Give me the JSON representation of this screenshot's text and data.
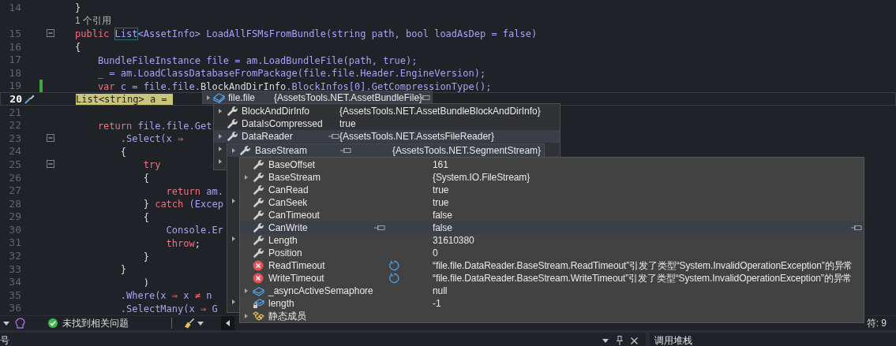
{
  "editor": {
    "lines": [
      {
        "kind": "code",
        "number": "14",
        "tokens": [
          {
            "kind": "punct",
            "text": "}"
          }
        ]
      },
      {
        "kind": "codelens",
        "text": "1 个引用"
      },
      {
        "kind": "code",
        "number": "15",
        "fold": true,
        "tokens": [
          {
            "kind": "keyword",
            "text": "public "
          },
          {
            "kind": "reference",
            "text": "List"
          },
          {
            "kind": "name",
            "text": "<AssetInfo> LoadAllFSMsFromBundle(string path, bool loadAsDep = false)"
          }
        ]
      },
      {
        "kind": "code",
        "number": "16",
        "tokens": [
          {
            "kind": "punct",
            "text": "{"
          }
        ]
      },
      {
        "kind": "code",
        "number": "17",
        "tokens": [
          {
            "kind": "name",
            "text": "    BundleFileInstance file = am.LoadBundleFile(path, true);"
          }
        ]
      },
      {
        "kind": "code",
        "number": "18",
        "tokens": [
          {
            "kind": "name",
            "text": "    _ = am.LoadClassDatabaseFromPackage(file.file.Header.EngineVersion);"
          }
        ]
      },
      {
        "kind": "code",
        "number": "19",
        "changed": true,
        "tokens": [
          {
            "kind": "keyword",
            "text": "    var"
          },
          {
            "kind": "name",
            "text": " c = file.file."
          },
          {
            "kind": "punct",
            "text": "BlockAndDirInfo"
          },
          {
            "kind": "name",
            "text": ".BlockInfos[0].GetCompressionType();"
          }
        ]
      },
      {
        "kind": "code",
        "number": "20",
        "current": true,
        "tokens": [
          {
            "kind": "highlight",
            "text": "List<string> a = "
          }
        ]
      },
      {
        "kind": "code",
        "number": "21"
      },
      {
        "kind": "code",
        "number": "22",
        "tokens": [
          {
            "kind": "keyword",
            "text": "    return"
          },
          {
            "kind": "name",
            "text": " file.file.Get"
          }
        ]
      },
      {
        "kind": "code",
        "number": "23",
        "fold": true,
        "tokens": [
          {
            "kind": "name",
            "text": "        .Select(x "
          },
          {
            "kind": "keyword",
            "text": "⇒"
          }
        ]
      },
      {
        "kind": "code",
        "number": "24",
        "tokens": [
          {
            "kind": "punct",
            "text": "        {"
          }
        ]
      },
      {
        "kind": "code",
        "number": "25",
        "fold": true,
        "tokens": [
          {
            "kind": "keyword",
            "text": "            try"
          }
        ]
      },
      {
        "kind": "code",
        "number": "26",
        "tokens": [
          {
            "kind": "punct",
            "text": "            {"
          }
        ]
      },
      {
        "kind": "code",
        "number": "27",
        "tokens": [
          {
            "kind": "keyword",
            "text": "                return"
          },
          {
            "kind": "name",
            "text": " am."
          }
        ]
      },
      {
        "kind": "code",
        "number": "28",
        "tokens": [
          {
            "kind": "punct",
            "text": "            } "
          },
          {
            "kind": "keyword",
            "text": "catch"
          },
          {
            "kind": "name",
            "text": " (Excep"
          }
        ]
      },
      {
        "kind": "code",
        "number": "29",
        "tokens": [
          {
            "kind": "punct",
            "text": "            {"
          }
        ]
      },
      {
        "kind": "code",
        "number": "30",
        "tokens": [
          {
            "kind": "name",
            "text": "                Console.Er"
          }
        ]
      },
      {
        "kind": "code",
        "number": "31",
        "tokens": [
          {
            "kind": "keyword",
            "text": "                throw"
          },
          {
            "kind": "punct",
            "text": ";"
          }
        ]
      },
      {
        "kind": "code",
        "number": "32",
        "tokens": [
          {
            "kind": "punct",
            "text": "            }"
          }
        ]
      },
      {
        "kind": "code",
        "number": "33",
        "tokens": [
          {
            "kind": "punct",
            "text": "        }"
          }
        ]
      },
      {
        "kind": "code",
        "number": "34",
        "tokens": [
          {
            "kind": "punct",
            "text": "            )"
          }
        ]
      },
      {
        "kind": "code",
        "number": "35",
        "tokens": [
          {
            "kind": "name",
            "text": "        .Where(x "
          },
          {
            "kind": "keyword",
            "text": "⇒"
          },
          {
            "kind": "name",
            "text": " x "
          },
          {
            "kind": "keyword",
            "text": "≠"
          },
          {
            "kind": "name",
            "text": " n"
          }
        ]
      },
      {
        "kind": "code",
        "number": "36",
        "tokens": [
          {
            "kind": "name",
            "text": "        .SelectMany(x "
          },
          {
            "kind": "keyword",
            "text": "⇒"
          },
          {
            "kind": "name",
            "text": " G"
          }
        ]
      }
    ]
  },
  "datatip": {
    "levels": [
      {
        "rows": [
          {
            "name": "file.file",
            "value": "{AssetsTools.NET.AssetBundleFile}",
            "kind": "class",
            "expandable": true,
            "hovered": true
          }
        ]
      },
      {
        "rows": [
          {
            "name": "BlockAndDirInfo",
            "value": "{AssetsTools.NET.AssetBundleBlockAndDirInfo}",
            "kind": "property",
            "expandable": true,
            "hovered": false
          },
          {
            "name": "DataIsCompressed",
            "value": "true",
            "kind": "property",
            "expandable": false,
            "hovered": false
          },
          {
            "name": "DataReader",
            "value": "{AssetsTools.NET.AssetsFileReader}",
            "kind": "property",
            "expandable": true,
            "hovered": true
          }
        ],
        "covered_rows": [
          {
            "expandable": true
          },
          {
            "expandable": true
          }
        ]
      },
      {
        "rows": [
          {
            "name": "BaseStream",
            "value": "{AssetsTools.NET.SegmentStream}",
            "kind": "property",
            "expandable": true,
            "hovered": true
          }
        ],
        "covered_rows": [
          {
            "expandable": false
          },
          {
            "expandable": false
          },
          {
            "expandable": false
          },
          {
            "expandable": true
          },
          {
            "expandable": false
          },
          {
            "expandable": false
          },
          {
            "expandable": true
          },
          {
            "expandable": false
          },
          {
            "expandable": false
          },
          {
            "expandable": false
          },
          {
            "expandable": false
          },
          {
            "expandable": true
          }
        ]
      },
      {
        "row_end_pins": true,
        "rows": [
          {
            "name": "BaseOffset",
            "value": "161",
            "kind": "property",
            "expandable": false,
            "hovered": false
          },
          {
            "name": "BaseStream",
            "value": "{System.IO.FileStream}",
            "kind": "property",
            "expandable": true,
            "hovered": false
          },
          {
            "name": "CanRead",
            "value": "true",
            "kind": "property",
            "expandable": false,
            "hovered": false
          },
          {
            "name": "CanSeek",
            "value": "true",
            "kind": "property",
            "expandable": false,
            "hovered": false
          },
          {
            "name": "CanTimeout",
            "value": "false",
            "kind": "property",
            "expandable": false,
            "hovered": false
          },
          {
            "name": "CanWrite",
            "value": "false",
            "kind": "property",
            "expandable": false,
            "hovered": true
          },
          {
            "name": "Length",
            "value": "31610380",
            "kind": "property",
            "expandable": false,
            "hovered": false
          },
          {
            "name": "Position",
            "value": "0",
            "kind": "property",
            "expandable": false,
            "hovered": false
          },
          {
            "name": "ReadTimeout",
            "value": "“file.file.DataReader.BaseStream.ReadTimeout”引发了类型“System.InvalidOperationException”的异常",
            "kind": "error",
            "refreshable": true,
            "expandable": false,
            "hovered": false
          },
          {
            "name": "WriteTimeout",
            "value": "“file.file.DataReader.BaseStream.WriteTimeout”引发了类型“System.InvalidOperationException”的异常",
            "kind": "error",
            "refreshable": true,
            "expandable": false,
            "hovered": false
          },
          {
            "name": "_asyncActiveSemaphore",
            "value": "null",
            "kind": "field",
            "expandable": true,
            "hovered": false
          },
          {
            "name": "length",
            "value": "-1",
            "kind": "private_field",
            "expandable": false,
            "hovered": false
          },
          {
            "name": "静态成员",
            "kind": "static",
            "expandable": true,
            "hovered": false
          }
        ]
      }
    ]
  },
  "status_bar": {
    "issues_text": "未找到相关问题",
    "position_text": "符: 9"
  },
  "bottom_panels": {
    "left_title": "号",
    "right_title": "调用堆栈"
  }
}
